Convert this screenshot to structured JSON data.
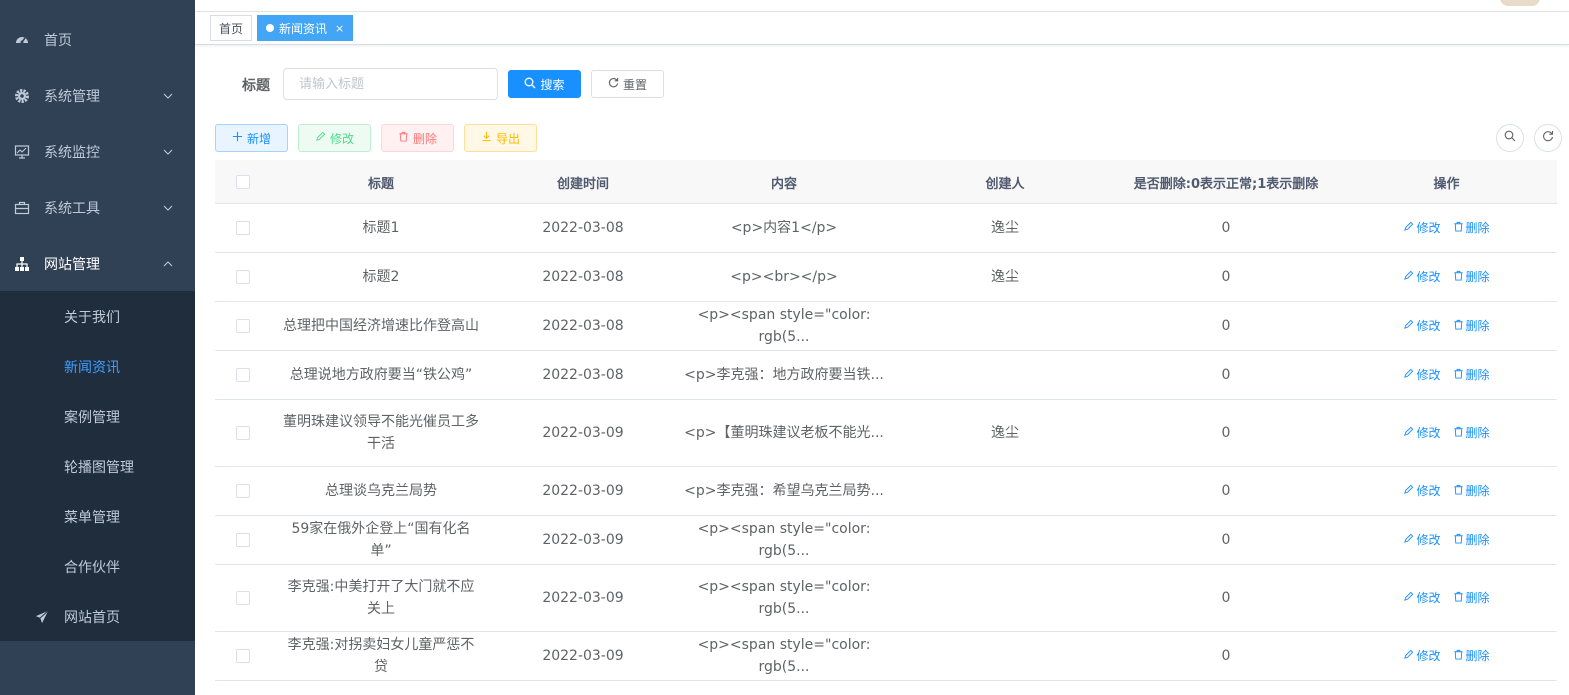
{
  "sidebar": {
    "items": [
      {
        "label": "首页",
        "icon": "dashboard-icon"
      },
      {
        "label": "系统管理",
        "icon": "gear-icon"
      },
      {
        "label": "系统监控",
        "icon": "monitor-icon"
      },
      {
        "label": "系统工具",
        "icon": "toolbox-icon"
      },
      {
        "label": "网站管理",
        "icon": "sitemap-icon"
      }
    ],
    "subitems": [
      {
        "label": "关于我们"
      },
      {
        "label": "新闻资讯"
      },
      {
        "label": "案例管理"
      },
      {
        "label": "轮播图管理"
      },
      {
        "label": "菜单管理"
      },
      {
        "label": "合作伙伴"
      },
      {
        "label": "网站首页",
        "icon": "paper-plane-icon"
      }
    ]
  },
  "tags": {
    "home": "首页",
    "active": "新闻资讯",
    "close": "×"
  },
  "search": {
    "label": "标题",
    "placeholder": "请输入标题",
    "search_label": "搜索",
    "reset_label": "重置"
  },
  "toolbar": {
    "add": "新增",
    "edit": "修改",
    "delete": "删除",
    "export": "导出"
  },
  "table": {
    "headers": [
      "标题",
      "创建时间",
      "内容",
      "创建人",
      "是否删除:0表示正常;1表示删除",
      "操作"
    ],
    "op_edit": "修改",
    "op_delete": "删除",
    "rows": [
      {
        "title": "标题1",
        "time": "2022-03-08",
        "content": "<p>内容1</p>",
        "creator": "逸尘",
        "deleted": "0"
      },
      {
        "title": "标题2",
        "time": "2022-03-08",
        "content": "<p><br></p>",
        "creator": "逸尘",
        "deleted": "0"
      },
      {
        "title": "总理把中国经济增速比作登高山",
        "time": "2022-03-08",
        "content": "<p><span style=\"color: rgb(5...",
        "creator": "",
        "deleted": "0"
      },
      {
        "title": "总理说地方政府要当“铁公鸡”",
        "time": "2022-03-08",
        "content": "<p>李克强：地方政府要当铁...",
        "creator": "",
        "deleted": "0"
      },
      {
        "title": "董明珠建议领导不能光催员工多干活",
        "time": "2022-03-09",
        "content": "<p>【董明珠建议老板不能光...",
        "creator": "逸尘",
        "deleted": "0"
      },
      {
        "title": "总理谈乌克兰局势",
        "time": "2022-03-09",
        "content": "<p>李克强：希望乌克兰局势...",
        "creator": "",
        "deleted": "0"
      },
      {
        "title": "59家在俄外企登上“国有化名单”",
        "time": "2022-03-09",
        "content": "<p><span style=\"color: rgb(5...",
        "creator": "",
        "deleted": "0"
      },
      {
        "title": "李克强:中美打开了大门就不应关上",
        "time": "2022-03-09",
        "content": "<p><span style=\"color: rgb(5...",
        "creator": "",
        "deleted": "0"
      },
      {
        "title": "李克强:对拐卖妇女儿童严惩不贷",
        "time": "2022-03-09",
        "content": "<p><span style=\"color: rgb(5...",
        "creator": "",
        "deleted": "0"
      }
    ]
  },
  "colors": {
    "sidebar_bg": "#304156",
    "submenu_bg": "#1f2d3d",
    "primary": "#1890ff",
    "active_tag": "#42a5f5"
  }
}
